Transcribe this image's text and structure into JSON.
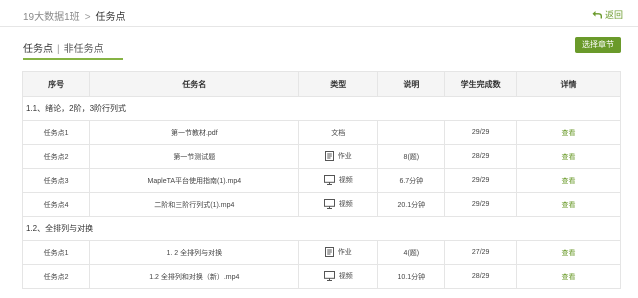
{
  "breadcrumb": {
    "class_name": "19大数据1班",
    "separator": ">",
    "current": "任务点"
  },
  "back": {
    "label": "返回"
  },
  "tabs": [
    {
      "label": "任务点"
    },
    {
      "label": "非任务点"
    }
  ],
  "tab_divider": "|",
  "chapter_button": {
    "label": "选择章节"
  },
  "table": {
    "headers": [
      "序号",
      "任务名",
      "类型",
      "说明",
      "学生完成数",
      "详情"
    ],
    "sections": [
      {
        "title": "1.1、绪论，2阶，3阶行列式",
        "rows": [
          {
            "index": "任务点1",
            "name": "第一节教材.pdf",
            "type": "文档",
            "type_icon": "",
            "note": "",
            "completed": "29/29",
            "detail": "查看"
          },
          {
            "index": "任务点2",
            "name": "第一节测试题",
            "type": "作业",
            "type_icon": "homework-icon",
            "note": "8(题)",
            "completed": "28/29",
            "detail": "查看"
          },
          {
            "index": "任务点3",
            "name": "MapleTA平台使用指南(1).mp4",
            "type": "视频",
            "type_icon": "video-icon",
            "note": "6.7分钟",
            "completed": "29/29",
            "detail": "查看"
          },
          {
            "index": "任务点4",
            "name": "二阶和三阶行列式(1).mp4",
            "type": "视频",
            "type_icon": "video-icon",
            "note": "20.1分钟",
            "completed": "29/29",
            "detail": "查看"
          }
        ]
      },
      {
        "title": "1.2、全排列与对换",
        "rows": [
          {
            "index": "任务点1",
            "name": "1. 2 全排列与对换",
            "type": "作业",
            "type_icon": "homework-icon",
            "note": "4(题)",
            "completed": "27/29",
            "detail": "查看"
          },
          {
            "index": "任务点2",
            "name": "1.2 全排列和对换（新）.mp4",
            "type": "视频",
            "type_icon": "video-icon",
            "note": "10.1分钟",
            "completed": "28/29",
            "detail": "查看"
          }
        ]
      }
    ]
  },
  "colors": {
    "accent": "#6a9a2a",
    "tab_underline": "#86b344",
    "header_bg": "#f5f5f5",
    "border": "#e5e5e5"
  }
}
